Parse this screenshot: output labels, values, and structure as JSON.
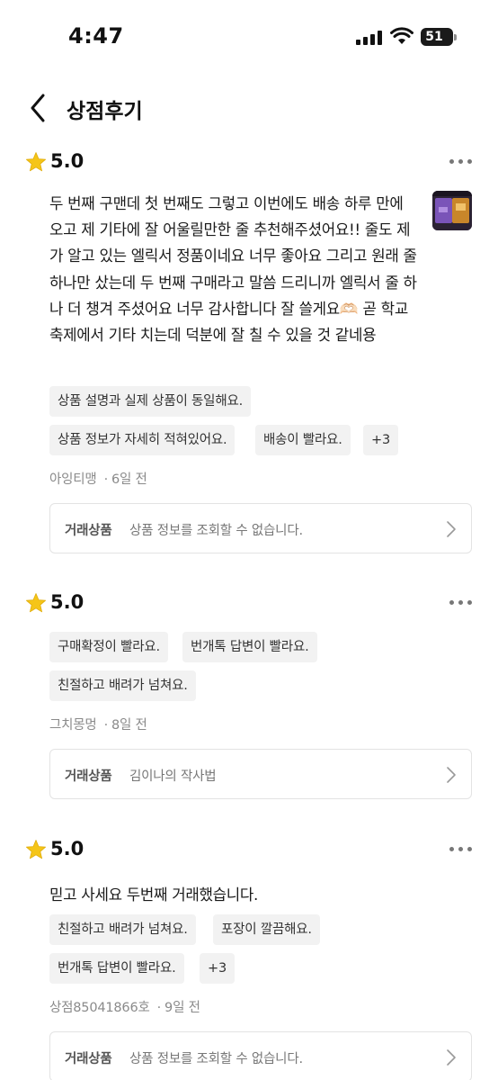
{
  "status": {
    "time": "4:47",
    "battery": "51"
  },
  "header": {
    "title": "상점후기"
  },
  "reviews": [
    {
      "score": "5.0",
      "body": "두 번째 구맨데 첫 번째도 그렇고 이번에도 배송 하루 만에 오고 제 기타에 잘 어울릴만한 줄 추천해주셨어요!! 줄도 제가 알고 있는 엘릭서 정품이네요 너무 좋아요 그리고 원래 줄 하나만 샀는데 두 번째 구매라고 말씀 드리니까 엘릭서 줄 하나 더 챙겨 주셨어요 너무 감사합니다 잘 쓸게요🫶🏻 곧 학교 축제에서 기타 치는데 덕분에 잘 칠 수 있을 것 같네용",
      "tags": [
        "상품 설명과 실제 상품이 동일해요.",
        "상품 정보가 자세히 적혀있어요.",
        "배송이 빨라요.",
        "+3"
      ],
      "author": "아잉티맹",
      "date": "6일 전",
      "product_label": "거래상품",
      "product_value": "상품 정보를 조회할 수 없습니다."
    },
    {
      "score": "5.0",
      "tags": [
        "구매확정이 빨라요.",
        "번개톡 답변이 빨라요.",
        "친절하고 배려가 넘쳐요."
      ],
      "author": "그치몽멍",
      "date": "8일 전",
      "product_label": "거래상품",
      "product_value": "김이나의 작사법"
    },
    {
      "score": "5.0",
      "body": "믿고 사세요 두번째 거래했습니다.",
      "tags": [
        "친절하고 배려가 넘쳐요.",
        "포장이 깔끔해요.",
        "번개톡 답변이 빨라요.",
        "+3"
      ],
      "author": "상점85041866호",
      "date": "9일 전",
      "product_label": "거래상품",
      "product_value": "상품 정보를 조회할 수 없습니다."
    }
  ],
  "colors": {
    "star": "#f5c518",
    "tag_bg": "#f2f2f2",
    "meta": "#8a8a8a",
    "border": "#e3e3e3"
  },
  "icons": [
    "back-chevron-icon",
    "star-icon",
    "more-dots-icon",
    "chevron-right-icon"
  ]
}
